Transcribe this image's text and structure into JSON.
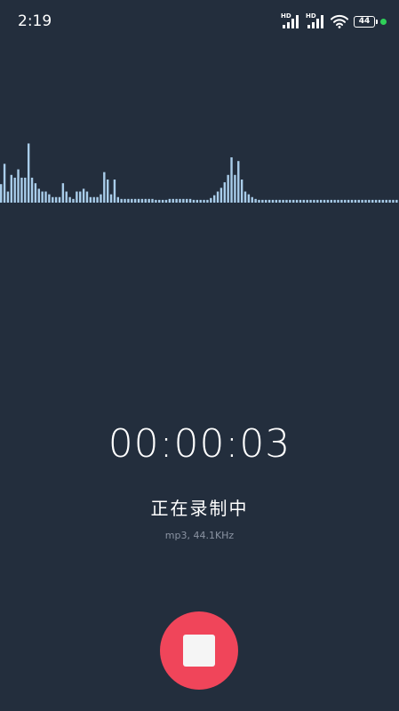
{
  "status_bar": {
    "time": "2:19",
    "signal_1_label": "HD",
    "signal_2_label": "HD",
    "battery_level": "44",
    "indicator_color": "#2fd159",
    "icons": [
      "hd-signal-icon",
      "hd-signal-icon",
      "wifi-icon",
      "battery-icon"
    ]
  },
  "recorder": {
    "elapsed_time": "00:00:03",
    "status": "正在录制中",
    "format": "mp3, 44.1KHz",
    "stop_button_color": "#f0455a",
    "stop_icon": "stop-icon"
  },
  "waveform": {
    "bar_color": "#a9cdea",
    "levels": [
      0.2,
      0.42,
      0.12,
      0.3,
      0.27,
      0.36,
      0.27,
      0.27,
      0.64,
      0.27,
      0.21,
      0.15,
      0.12,
      0.12,
      0.09,
      0.06,
      0.06,
      0.06,
      0.21,
      0.12,
      0.06,
      0.04,
      0.12,
      0.12,
      0.15,
      0.12,
      0.06,
      0.06,
      0.06,
      0.09,
      0.33,
      0.25,
      0.09,
      0.25,
      0.06,
      0.04,
      0.04,
      0.04,
      0.04,
      0.04,
      0.04,
      0.04,
      0.04,
      0.04,
      0.04,
      0.03,
      0.03,
      0.03,
      0.03,
      0.04,
      0.04,
      0.04,
      0.04,
      0.04,
      0.04,
      0.04,
      0.03,
      0.03,
      0.03,
      0.03,
      0.03,
      0.05,
      0.08,
      0.12,
      0.16,
      0.22,
      0.3,
      0.49,
      0.3,
      0.45,
      0.25,
      0.12,
      0.09,
      0.06,
      0.04,
      0.03,
      0.03,
      0.03,
      0.03,
      0.03,
      0.03,
      0.03,
      0.03,
      0.03,
      0.03,
      0.03,
      0.03,
      0.03,
      0.03,
      0.03,
      0.03,
      0.03,
      0.03,
      0.03,
      0.03,
      0.03,
      0.03,
      0.03,
      0.03,
      0.03,
      0.03,
      0.03,
      0.03,
      0.03,
      0.03,
      0.03,
      0.03,
      0.03,
      0.03,
      0.03,
      0.03,
      0.03,
      0.03,
      0.03,
      0.03,
      0.03
    ]
  }
}
